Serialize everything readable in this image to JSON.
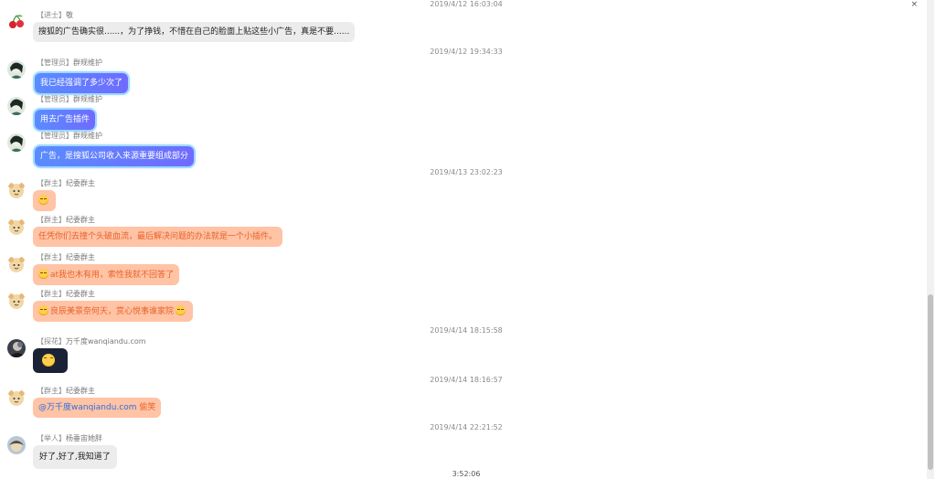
{
  "window": {
    "close_glyph": "×"
  },
  "timestamps": [
    "2019/4/12 16:03:04",
    "2019/4/12 19:34:33",
    "2019/4/13 23:02:23",
    "2019/4/14 18:15:58",
    "2019/4/14 18:16:57",
    "2019/4/14 22:21:52"
  ],
  "messages": [
    {
      "tag": "【进士】",
      "name": "敬",
      "text": "搜狐的广告确实很......，为了挣钱，不惜在自己的脸面上贴这些小广告，真是不要......",
      "style": "gray",
      "avatar": "cherry-avatar"
    },
    {
      "tag": "【管理员】",
      "name": "群规维护",
      "text": "我已经强调了多少次了",
      "style": "blue",
      "avatar": "admin-avatar"
    },
    {
      "tag": "【管理员】",
      "name": "群规维护",
      "text": "用去广告插件",
      "style": "blue",
      "avatar": "admin-avatar"
    },
    {
      "tag": "【管理员】",
      "name": "群规维护",
      "text": "广告，是搜狐公司收入来源重要组成部分",
      "style": "blue",
      "avatar": "admin-avatar"
    },
    {
      "tag": "【群主】",
      "name": "纪委群主",
      "text": "",
      "style": "orange",
      "avatar": "owner-avatar"
    },
    {
      "tag": "【群主】",
      "name": "纪委群主",
      "text": "任凭你们去撞个头破血流，最后解决问题的办法就是一个小插件。",
      "style": "orange",
      "avatar": "owner-avatar"
    },
    {
      "tag": "【群主】",
      "name": "纪委群主",
      "text": "at我也木有用，索性我就不回答了",
      "style": "orange",
      "avatar": "owner-avatar"
    },
    {
      "tag": "【群主】",
      "name": "纪委群主",
      "text": "良辰美景奈何天，赏心悦事谁家院",
      "style": "orange",
      "avatar": "owner-avatar"
    },
    {
      "tag": "【探花】",
      "name": "万千度wanqiandu.com",
      "text": "",
      "style": "dark",
      "avatar": "user-avatar"
    },
    {
      "tag": "【群主】",
      "name": "纪委群主",
      "mention": "@万千度wanqiandu.com",
      "text": " 偷笑",
      "style": "orange",
      "avatar": "owner-avatar"
    },
    {
      "tag": "【举人】",
      "name": "杨垂宙她胖",
      "text": "好了,好了,我知道了",
      "style": "gray",
      "avatar": "user2-avatar"
    }
  ],
  "footer": {
    "time": "3:52:06"
  },
  "colors": {
    "accent_blue": "#5a8cff",
    "orange_bubble": "#ffc3a5",
    "orange_text": "#e8622a",
    "gray_bubble": "#ececec"
  }
}
